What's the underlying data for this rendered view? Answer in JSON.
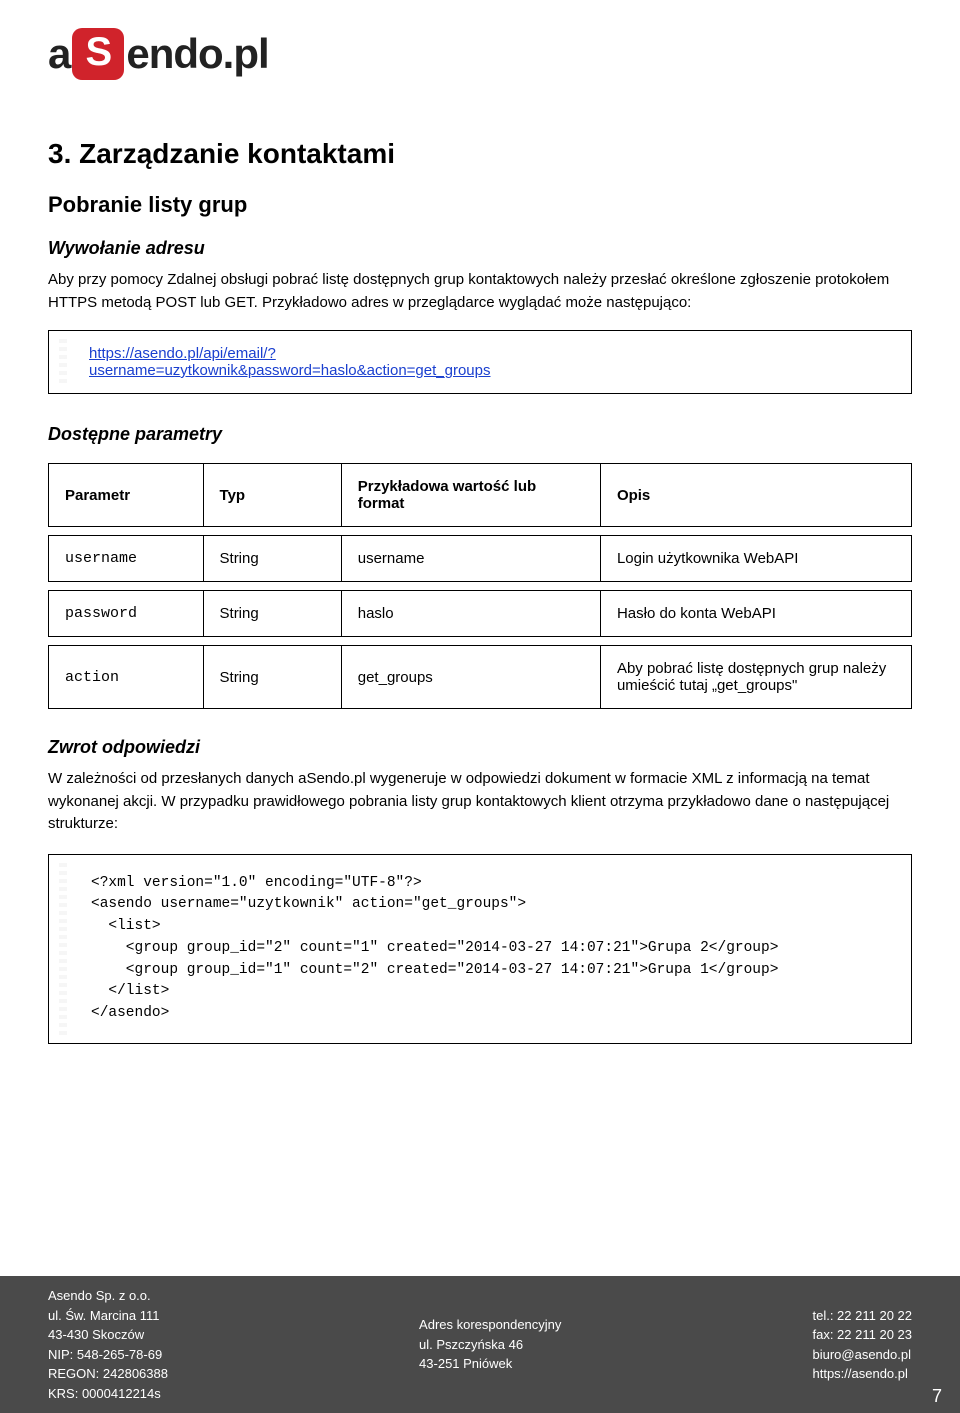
{
  "logo": {
    "prefix": "a",
    "badge": "S",
    "suffix": "endo.pl"
  },
  "section_title": "3. Zarządzanie kontaktami",
  "sub_title": "Pobranie listy grup",
  "call_heading": "Wywołanie adresu",
  "call_paragraph": "Aby przy pomocy Zdalnej obsługi pobrać listę dostępnych grup kontaktowych należy przesłać określone zgłoszenie protokołem HTTPS metodą POST lub GET. Przykładowo adres w przeglądarce wyglądać może następująco:",
  "url_line1": "https://asendo.pl/api/email/?",
  "url_line2": "username=uzytkownik&password=haslo&action=get_groups",
  "params_heading": "Dostępne parametry",
  "params_header": {
    "c1": "Parametr",
    "c2": "Typ",
    "c3": "Przykładowa wartość lub format",
    "c4": "Opis"
  },
  "params_rows": {
    "r0": {
      "c1": "username",
      "c2": "String",
      "c3": "username",
      "c4": "Login użytkownika WebAPI"
    },
    "r1": {
      "c1": "password",
      "c2": "String",
      "c3": "haslo",
      "c4": "Hasło do konta WebAPI"
    },
    "r2": {
      "c1": "action",
      "c2": "String",
      "c3": "get_groups",
      "c4": "Aby pobrać listę dostępnych grup należy umieścić tutaj „get_groups\""
    }
  },
  "response_heading": "Zwrot odpowiedzi",
  "response_paragraph": "W zależności od przesłanych danych aSendo.pl wygeneruje w odpowiedzi dokument w formacie XML z informacją na temat wykonanej akcji. W przypadku prawidłowego pobrania listy grup kontaktowych klient otrzyma przykładowo dane o następującej strukturze:",
  "xml_example": "<?xml version=\"1.0\" encoding=\"UTF-8\"?>\n<asendo username=\"uzytkownik\" action=\"get_groups\">\n  <list>\n    <group group_id=\"2\" count=\"1\" created=\"2014-03-27 14:07:21\">Grupa 2</group>\n    <group group_id=\"1\" count=\"2\" created=\"2014-03-27 14:07:21\">Grupa 1</group>\n  </list>\n</asendo>",
  "footer": {
    "left": "Asendo Sp. z o.o.\nul. Św. Marcina 111\n43-430 Skoczów\nNIP: 548-265-78-69\nREGON: 242806388\nKRS: 0000412214s",
    "middle": "Adres korespondencyjny\nul. Pszczyńska 46\n43-251 Pniówek",
    "right": "tel.: 22 211 20 22\nfax: 22 211 20 23\nbiuro@asendo.pl\nhttps://asendo.pl",
    "page": "7"
  }
}
